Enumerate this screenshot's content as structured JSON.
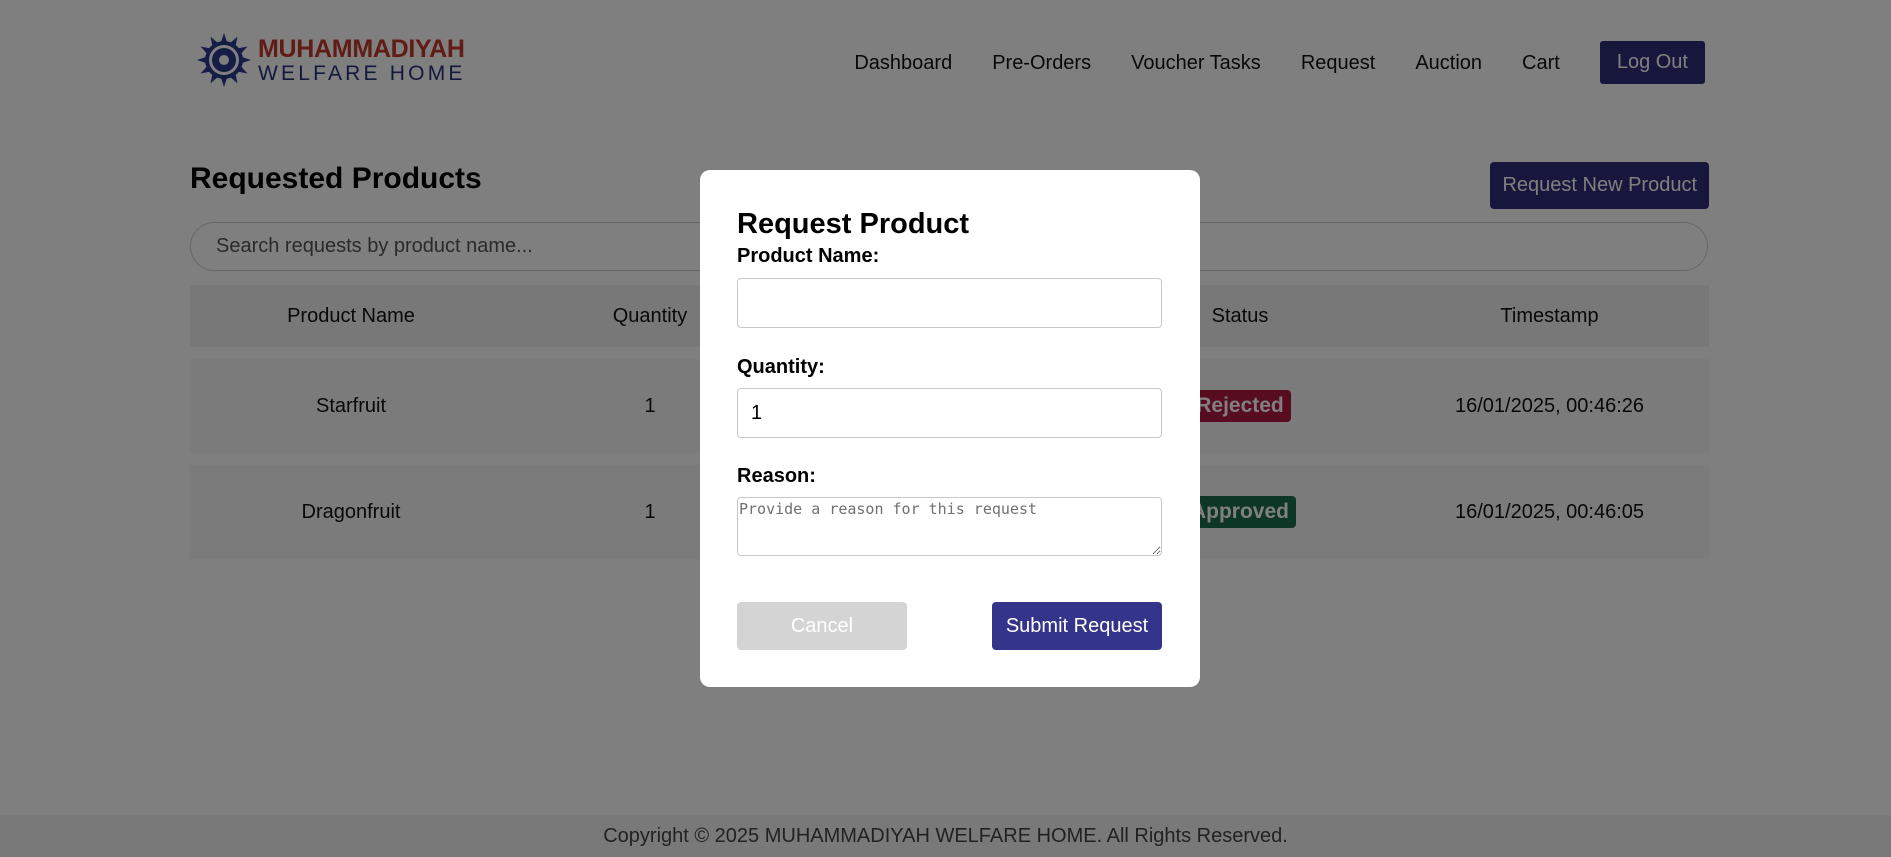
{
  "brand": {
    "line1": "MUHAMMADIYAH",
    "line2": "WELFARE HOME",
    "colors": {
      "red": "#c0392b",
      "navy": "#25337a"
    }
  },
  "nav": {
    "items": [
      {
        "label": "Dashboard"
      },
      {
        "label": "Pre-Orders"
      },
      {
        "label": "Voucher Tasks"
      },
      {
        "label": "Request"
      },
      {
        "label": "Auction"
      },
      {
        "label": "Cart"
      }
    ],
    "logout_label": "Log Out"
  },
  "main": {
    "title": "Requested Products",
    "new_request_label": "Request New Product",
    "search_placeholder": "Search requests by product name...",
    "table": {
      "columns": [
        "Product Name",
        "Quantity",
        "",
        "Status",
        "Timestamp"
      ],
      "rows": [
        {
          "product": "Starfruit",
          "quantity": "1",
          "status": "Rejected",
          "status_color": "#b0193f",
          "timestamp": "16/01/2025, 00:46:26"
        },
        {
          "product": "Dragonfruit",
          "quantity": "1",
          "status": "Approved",
          "status_color": "#1a6e48",
          "timestamp": "16/01/2025, 00:46:05"
        }
      ]
    }
  },
  "footer": {
    "copyright": "Copyright © 2025 MUHAMMADIYAH WELFARE HOME. All Rights Reserved."
  },
  "modal": {
    "title": "Request Product",
    "product_name_label": "Product Name:",
    "product_name_value": "",
    "quantity_label": "Quantity:",
    "quantity_value": "1",
    "reason_label": "Reason:",
    "reason_placeholder": "Provide a reason for this request",
    "cancel_label": "Cancel",
    "submit_label": "Submit Request"
  },
  "theme": {
    "primary": "#2f2f7a",
    "overlay": "rgba(0,0,0,0.5)"
  }
}
